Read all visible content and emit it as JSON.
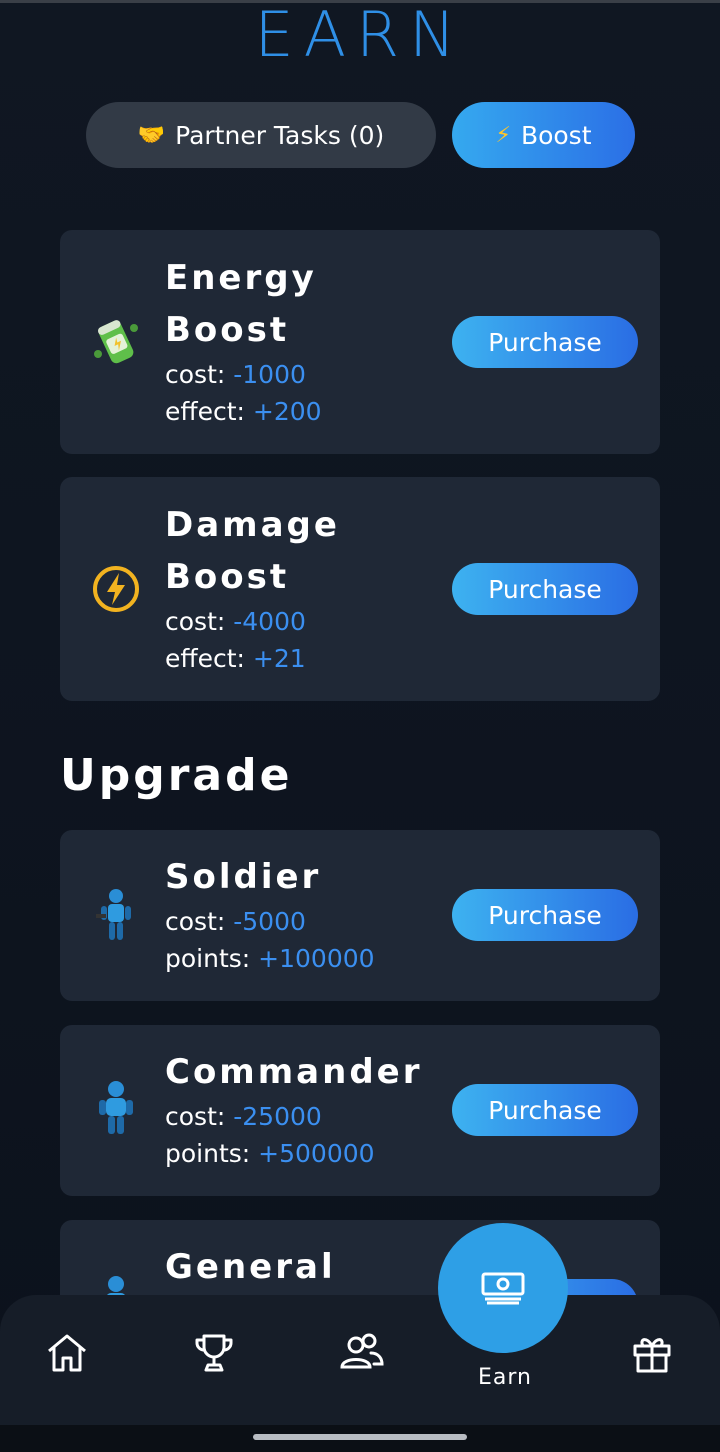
{
  "header": {
    "title": "EARN"
  },
  "tabs": [
    {
      "icon": "handshake-icon",
      "label": "Partner Tasks (0)"
    },
    {
      "icon": "lightning-icon",
      "label": "Boost"
    }
  ],
  "boosts": [
    {
      "name": "Energy",
      "name2": "Boost",
      "icon": "energy-can-icon",
      "cost_label": "cost:",
      "cost": "-1000",
      "effect_label": "effect:",
      "effect": "+200",
      "button": "Purchase"
    },
    {
      "name": "Damage",
      "name2": "Boost",
      "icon": "lightning-circle-icon",
      "cost_label": "cost:",
      "cost": "-4000",
      "effect_label": "effect:",
      "effect": "+21",
      "button": "Purchase"
    }
  ],
  "upgrade": {
    "title": "Upgrade",
    "items": [
      {
        "name": "Soldier",
        "icon": "soldier-icon",
        "cost_label": "cost:",
        "cost": "-5000",
        "points_label": "points:",
        "points": "+100000",
        "button": "Purchase"
      },
      {
        "name": "Commander",
        "icon": "commander-icon",
        "cost_label": "cost:",
        "cost": "-25000",
        "points_label": "points:",
        "points": "+500000",
        "button": "Purchase"
      },
      {
        "name": "General",
        "icon": "general-icon",
        "button": "Purchase"
      }
    ]
  },
  "nav": {
    "items": [
      {
        "icon": "home-icon"
      },
      {
        "icon": "trophy-icon"
      },
      {
        "icon": "friends-icon"
      },
      {
        "icon": "money-icon",
        "label": "Earn",
        "active": true
      },
      {
        "icon": "gift-icon"
      }
    ]
  },
  "colors": {
    "accent": "#2f8fe6",
    "value": "#3b8ff0",
    "card": "#1f2836",
    "background": "#0e1520"
  }
}
